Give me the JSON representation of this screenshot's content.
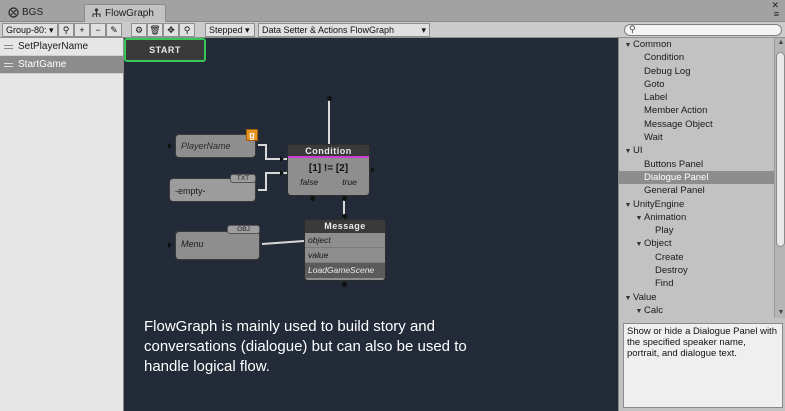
{
  "tabs": [
    {
      "label": "BGS",
      "active": false
    },
    {
      "label": "FlowGraph",
      "active": true
    }
  ],
  "toolbar": {
    "group_select": "Group-80:",
    "search_icon": "magnifier-icon",
    "add_label": "+",
    "remove_label": "−",
    "mode_select": "Stepped",
    "flow_select": "Data Setter & Actions FlowGraph"
  },
  "graphs": [
    {
      "label": "SetPlayerName",
      "selected": false
    },
    {
      "label": "StartGame",
      "selected": true
    }
  ],
  "canvas": {
    "start_label": "START",
    "condition": {
      "title": "Condition",
      "expression": "[1] != [2]",
      "out_false": "false",
      "out_true": "true"
    },
    "variables": {
      "player": "PlayerName",
      "player_badge": "g",
      "empty": "-empty-",
      "empty_badge": "TXT",
      "menu": "Menu",
      "menu_badge": "OBJ"
    },
    "message": {
      "title": "Message",
      "rows": [
        "object",
        "value",
        "LoadGameScene"
      ]
    },
    "caption": "FlowGraph is mainly used to build story and conversations (dialogue) but can also be used to handle logical flow."
  },
  "node_tree": [
    {
      "label": "Common",
      "depth": 0,
      "arrow": "▼",
      "selected": false
    },
    {
      "label": "Condition",
      "depth": 1,
      "arrow": "",
      "selected": false
    },
    {
      "label": "Debug Log",
      "depth": 1,
      "arrow": "",
      "selected": false
    },
    {
      "label": "Goto",
      "depth": 1,
      "arrow": "",
      "selected": false
    },
    {
      "label": "Label",
      "depth": 1,
      "arrow": "",
      "selected": false
    },
    {
      "label": "Member Action",
      "depth": 1,
      "arrow": "",
      "selected": false
    },
    {
      "label": "Message Object",
      "depth": 1,
      "arrow": "",
      "selected": false
    },
    {
      "label": "Wait",
      "depth": 1,
      "arrow": "",
      "selected": false
    },
    {
      "label": "UI",
      "depth": 0,
      "arrow": "▼",
      "selected": false
    },
    {
      "label": "Buttons Panel",
      "depth": 1,
      "arrow": "",
      "selected": false
    },
    {
      "label": "Dialogue Panel",
      "depth": 1,
      "arrow": "",
      "selected": true
    },
    {
      "label": "General Panel",
      "depth": 1,
      "arrow": "",
      "selected": false
    },
    {
      "label": "UnityEngine",
      "depth": 0,
      "arrow": "▼",
      "selected": false
    },
    {
      "label": "Animation",
      "depth": 1,
      "arrow": "▼",
      "selected": false
    },
    {
      "label": "Play",
      "depth": 2,
      "arrow": "",
      "selected": false
    },
    {
      "label": "Object",
      "depth": 1,
      "arrow": "▼",
      "selected": false
    },
    {
      "label": "Create",
      "depth": 2,
      "arrow": "",
      "selected": false
    },
    {
      "label": "Destroy",
      "depth": 2,
      "arrow": "",
      "selected": false
    },
    {
      "label": "Find",
      "depth": 2,
      "arrow": "",
      "selected": false
    },
    {
      "label": "Value",
      "depth": 0,
      "arrow": "▼",
      "selected": false
    },
    {
      "label": "Calc",
      "depth": 1,
      "arrow": "▼",
      "selected": false
    }
  ],
  "description": "Show or hide a Dialogue Panel with the specified speaker name, portrait, and dialogue text.",
  "colors": {
    "canvas_bg": "#232a38",
    "start_border": "#34c95a",
    "condition_accent": "#d23bd2",
    "var_badge": "#e59422"
  }
}
